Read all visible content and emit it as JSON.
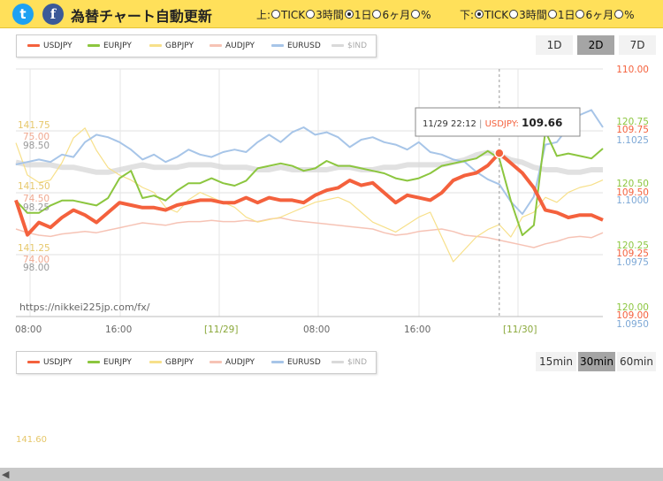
{
  "header": {
    "twitter_icon": "t",
    "facebook_icon": "f",
    "title": "為替チャート自動更新",
    "upper_label": "上:",
    "lower_label": "下:",
    "radio_options": [
      "TICK",
      "3時間",
      "1日",
      "6ヶ月",
      "%"
    ],
    "upper_selected": 2,
    "lower_selected": 0
  },
  "legend": [
    {
      "name": "USDJPY",
      "color": "#f4613d"
    },
    {
      "name": "EURJPY",
      "color": "#8cc63f"
    },
    {
      "name": "GBPJPY",
      "color": "#f7e08a"
    },
    {
      "name": "AUDJPY",
      "color": "#f6c3b5"
    },
    {
      "name": "EURUSD",
      "color": "#a7c5e8"
    },
    {
      "name": "$IND",
      "color": "#d9d9d9"
    }
  ],
  "period_buttons": [
    "1D",
    "2D",
    "7D"
  ],
  "period_active": "2D",
  "interval_buttons": [
    "15min",
    "30min",
    "60min"
  ],
  "interval_active": "30min",
  "watermark": "https://nikkei225jp.com/fx/",
  "tooltip": {
    "time": "11/29 22:12",
    "separator": "|",
    "series": "USDJPY:",
    "value": "109.66"
  },
  "chart_data": {
    "type": "line",
    "x_ticks": [
      "08:00",
      "16:00",
      "[11/29]",
      "08:00",
      "16:00",
      "[11/30]"
    ],
    "right_axis": {
      "usdjpy": {
        "color": "#f4613d",
        "ticks": [
          "110.00",
          "109.75",
          "109.50",
          "109.25",
          "109.00"
        ]
      },
      "eurjpy": {
        "color": "#8cc63f",
        "ticks": [
          "120.75",
          "120.50",
          "120.25",
          "120.00"
        ]
      },
      "eurusd": {
        "color": "#7da8d6",
        "ticks": [
          "1.1025",
          "1.1000",
          "1.0975",
          "1.0950"
        ]
      }
    },
    "left_axis": {
      "gbpjpy": {
        "color": "#e6c76a",
        "ticks": [
          "141.75",
          "141.50",
          "141.25"
        ]
      },
      "audjpy": {
        "color": "#f0a890",
        "ticks": [
          "75.00",
          "74.50",
          "74.00"
        ]
      },
      "dollar_index": {
        "color": "#999999",
        "ticks": [
          "98.50",
          "98.25",
          "98.00"
        ]
      }
    },
    "series": [
      {
        "name": "USDJPY",
        "color": "#f4613d",
        "values": [
          109.47,
          109.33,
          109.38,
          109.36,
          109.4,
          109.43,
          109.41,
          109.38,
          109.42,
          109.46,
          109.45,
          109.44,
          109.44,
          109.43,
          109.45,
          109.46,
          109.47,
          109.47,
          109.46,
          109.46,
          109.48,
          109.46,
          109.48,
          109.47,
          109.47,
          109.46,
          109.49,
          109.51,
          109.52,
          109.55,
          109.53,
          109.54,
          109.5,
          109.46,
          109.49,
          109.48,
          109.47,
          109.5,
          109.55,
          109.57,
          109.58,
          109.61,
          109.66,
          109.62,
          109.58,
          109.52,
          109.43,
          109.42,
          109.4,
          109.41,
          109.41,
          109.39
        ]
      },
      {
        "name": "EURJPY",
        "color": "#8cc63f",
        "values": [
          120.44,
          120.39,
          120.39,
          120.42,
          120.44,
          120.44,
          120.43,
          120.42,
          120.45,
          120.53,
          120.56,
          120.45,
          120.46,
          120.44,
          120.48,
          120.51,
          120.51,
          120.53,
          120.51,
          120.5,
          120.52,
          120.57,
          120.58,
          120.59,
          120.58,
          120.56,
          120.57,
          120.6,
          120.58,
          120.58,
          120.57,
          120.56,
          120.55,
          120.53,
          120.52,
          120.53,
          120.55,
          120.58,
          120.59,
          120.6,
          120.61,
          120.64,
          120.61,
          120.44,
          120.3,
          120.34,
          120.72,
          120.62,
          120.63,
          120.62,
          120.61,
          120.65
        ]
      },
      {
        "name": "GBPJPY",
        "color": "#f7e08a",
        "values": [
          141.68,
          141.55,
          141.52,
          141.53,
          141.6,
          141.7,
          141.74,
          141.65,
          141.58,
          141.55,
          141.53,
          141.5,
          141.48,
          141.42,
          141.4,
          141.45,
          141.48,
          141.46,
          141.44,
          141.42,
          141.38,
          141.36,
          141.37,
          141.38,
          141.4,
          141.42,
          141.44,
          141.45,
          141.46,
          141.44,
          141.4,
          141.36,
          141.34,
          141.32,
          141.35,
          141.38,
          141.4,
          141.3,
          141.2,
          141.25,
          141.3,
          141.33,
          141.35,
          141.3,
          141.38,
          141.4,
          141.46,
          141.44,
          141.48,
          141.5,
          141.51,
          141.53
        ]
      },
      {
        "name": "AUDJPY",
        "color": "#f6c3b5",
        "values": [
          74.25,
          74.22,
          74.2,
          74.19,
          74.21,
          74.22,
          74.23,
          74.22,
          74.24,
          74.26,
          74.28,
          74.3,
          74.29,
          74.28,
          74.3,
          74.31,
          74.31,
          74.32,
          74.31,
          74.31,
          74.32,
          74.31,
          74.33,
          74.34,
          74.32,
          74.31,
          74.3,
          74.29,
          74.28,
          74.27,
          74.26,
          74.25,
          74.22,
          74.2,
          74.21,
          74.23,
          74.24,
          74.25,
          74.23,
          74.2,
          74.19,
          74.18,
          74.16,
          74.14,
          74.12,
          74.1,
          74.13,
          74.15,
          74.18,
          74.19,
          74.18,
          74.22
        ]
      },
      {
        "name": "EURUSD",
        "color": "#a7c5e8",
        "values": [
          1.1015,
          1.1016,
          1.1017,
          1.1016,
          1.1019,
          1.1018,
          1.1024,
          1.1027,
          1.1026,
          1.1024,
          1.1021,
          1.1017,
          1.1019,
          1.1016,
          1.1018,
          1.1021,
          1.1019,
          1.1018,
          1.102,
          1.1021,
          1.102,
          1.1024,
          1.1027,
          1.1024,
          1.1028,
          1.103,
          1.1027,
          1.1028,
          1.1026,
          1.1022,
          1.1025,
          1.1026,
          1.1024,
          1.1023,
          1.1021,
          1.1024,
          1.102,
          1.1019,
          1.1017,
          1.1016,
          1.1012,
          1.1009,
          1.1007,
          1.1,
          1.0995,
          1.1002,
          1.1023,
          1.1024,
          1.103,
          1.1035,
          1.1037,
          1.103
        ]
      },
      {
        "name": "$IND",
        "color": "#d9d9d9",
        "values": [
          98.43,
          98.42,
          98.42,
          98.42,
          98.41,
          98.41,
          98.4,
          98.39,
          98.39,
          98.4,
          98.41,
          98.42,
          98.41,
          98.41,
          98.41,
          98.42,
          98.42,
          98.42,
          98.41,
          98.41,
          98.41,
          98.4,
          98.4,
          98.41,
          98.4,
          98.4,
          98.4,
          98.4,
          98.41,
          98.41,
          98.4,
          98.4,
          98.41,
          98.41,
          98.42,
          98.42,
          98.42,
          98.42,
          98.43,
          98.44,
          98.46,
          98.47,
          98.46,
          98.44,
          98.43,
          98.41,
          98.4,
          98.4,
          98.39,
          98.39,
          98.4,
          98.4
        ]
      }
    ],
    "tooltip_index": 42
  },
  "chart2": {
    "gbpjpy_tick": "141.60"
  }
}
